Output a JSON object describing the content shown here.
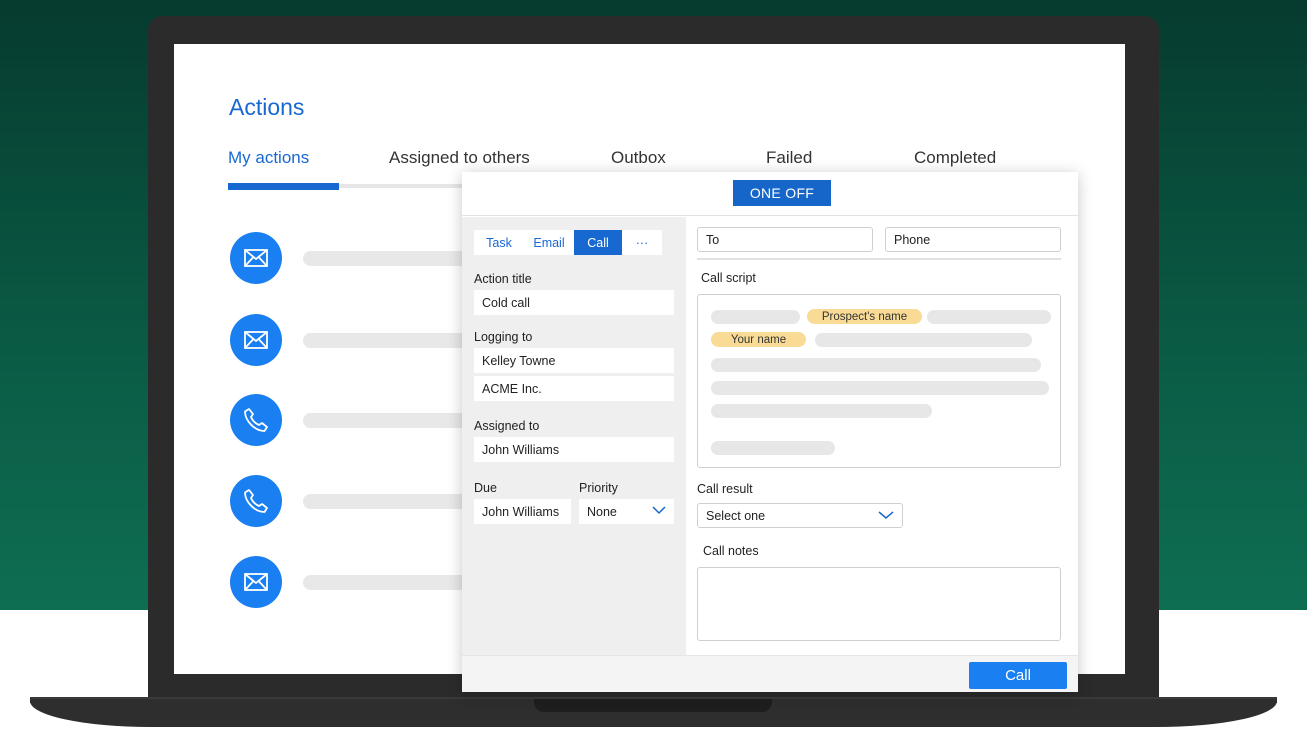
{
  "page": {
    "title": "Actions",
    "tabs": [
      {
        "label": "My actions",
        "active": true
      },
      {
        "label": "Assigned to others",
        "active": false
      },
      {
        "label": "Outbox",
        "active": false
      },
      {
        "label": "Failed",
        "active": false
      },
      {
        "label": "Completed",
        "active": false
      }
    ],
    "actions": [
      {
        "icon": "envelope-icon"
      },
      {
        "icon": "envelope-icon"
      },
      {
        "icon": "phone-icon"
      },
      {
        "icon": "phone-icon"
      },
      {
        "icon": "envelope-icon"
      }
    ]
  },
  "modal": {
    "header_button": "ONE OFF",
    "type_tabs": [
      {
        "label": "Task",
        "active": false
      },
      {
        "label": "Email",
        "active": false
      },
      {
        "label": "Call",
        "active": true
      },
      {
        "label": "···",
        "active": false
      }
    ],
    "action_title": {
      "label": "Action title",
      "value": "Cold call"
    },
    "logging_to": {
      "label": "Logging to",
      "contact": "Kelley Towne",
      "company": "ACME Inc."
    },
    "assigned_to": {
      "label": "Assigned to",
      "value": "John Williams"
    },
    "due": {
      "label": "Due",
      "value": "John Williams"
    },
    "priority": {
      "label": "Priority",
      "value": "None"
    },
    "to_field": {
      "value": "To"
    },
    "phone_field": {
      "value": "Phone"
    },
    "call_script": {
      "label": "Call script",
      "tag_prospect": "Prospect's name",
      "tag_your_name": "Your name"
    },
    "call_result": {
      "label": "Call result",
      "value": "Select one"
    },
    "call_notes": {
      "label": "Call notes"
    },
    "call_button": "Call"
  },
  "colors": {
    "accent": "#1769d1",
    "icon_blue": "#1a7ff0",
    "tag_yellow": "#f9db95",
    "background_green": "#0a5a44"
  }
}
